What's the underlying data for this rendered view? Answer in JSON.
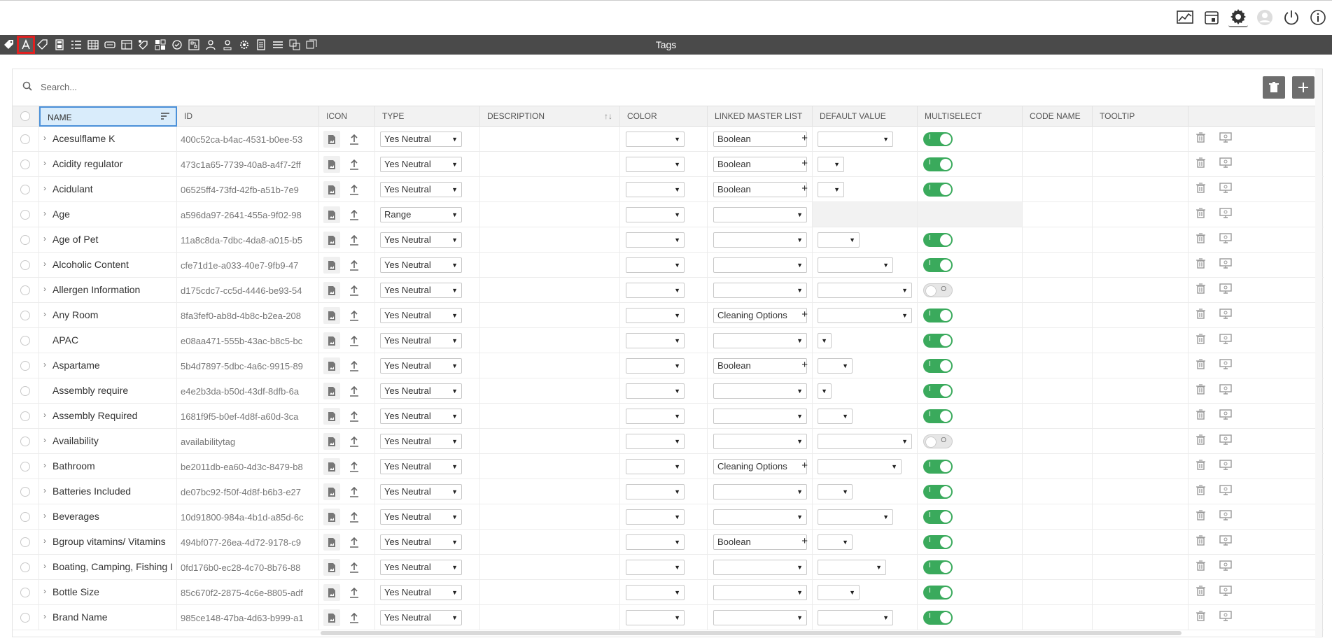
{
  "header": {
    "icons": [
      "chart-icon",
      "calendar-icon",
      "gear-icon",
      "user-icon",
      "power-icon",
      "info-icon"
    ]
  },
  "toolbar": {
    "title": "Tags",
    "icons": [
      "tag-icon",
      "attribute-icon",
      "tag-outline-icon",
      "calculator-icon",
      "checklist-icon",
      "table-icon",
      "card-icon",
      "layout-icon",
      "tag-share-icon",
      "grid-icon",
      "check-circle-icon",
      "tree-icon",
      "person-icon",
      "person-outline-icon",
      "settings-cog-icon",
      "document-list-icon",
      "lines-icon",
      "copy-icon",
      "duplicate-icon"
    ]
  },
  "search": {
    "placeholder": "Search..."
  },
  "columns": {
    "name": "NAME",
    "id": "ID",
    "icon": "ICON",
    "type": "TYPE",
    "description": "DESCRIPTION",
    "color": "COLOR",
    "linked": "LINKED MASTER LIST",
    "default": "DEFAULT VALUE",
    "multiselect": "MULTISELECT",
    "code": "CODE NAME",
    "tooltip": "TOOLTIP"
  },
  "rows": [
    {
      "name": "Acesulflame K",
      "id": "400c52ca-b4ac-4531-b0ee-53",
      "expand": true,
      "type": "Yes Neutral",
      "linked": "Boolean",
      "multiselect": "on"
    },
    {
      "name": "Acidity regulator",
      "id": "473c1a65-7739-40a8-a4f7-2ff",
      "expand": true,
      "type": "Yes Neutral",
      "linked": "Boolean",
      "multiselect": "on"
    },
    {
      "name": "Acidulant",
      "id": "06525ff4-73fd-42fb-a51b-7e9",
      "expand": true,
      "type": "Yes Neutral",
      "linked": "Boolean",
      "multiselect": "on"
    },
    {
      "name": "Age",
      "id": "a596da97-2641-455a-9f02-98",
      "expand": true,
      "type": "Range",
      "linked": "",
      "multiselect": "none"
    },
    {
      "name": "Age of Pet",
      "id": "11a8c8da-7dbc-4da8-a015-b5",
      "expand": true,
      "type": "Yes Neutral",
      "linked": "",
      "multiselect": "on"
    },
    {
      "name": "Alcoholic Content",
      "id": "cfe71d1e-a033-40e7-9fb9-47",
      "expand": true,
      "type": "Yes Neutral",
      "linked": "",
      "multiselect": "on"
    },
    {
      "name": "Allergen Information",
      "id": "d175cdc7-cc5d-4446-be93-54",
      "expand": true,
      "type": "Yes Neutral",
      "linked": "",
      "multiselect": "off"
    },
    {
      "name": "Any Room",
      "id": "8fa3fef0-ab8d-4b8c-b2ea-208",
      "expand": true,
      "type": "Yes Neutral",
      "linked": "Cleaning Options",
      "multiselect": "on"
    },
    {
      "name": "APAC",
      "id": "e08aa471-555b-43ac-b8c5-bc",
      "expand": false,
      "type": "Yes Neutral",
      "linked": "",
      "multiselect": "on"
    },
    {
      "name": "Aspartame",
      "id": "5b4d7897-5dbc-4a6c-9915-89",
      "expand": true,
      "type": "Yes Neutral",
      "linked": "Boolean",
      "multiselect": "on"
    },
    {
      "name": "Assembly require",
      "id": "e4e2b3da-b50d-43df-8dfb-6a",
      "expand": false,
      "type": "Yes Neutral",
      "linked": "",
      "multiselect": "on"
    },
    {
      "name": "Assembly Required",
      "id": "1681f9f5-b0ef-4d8f-a60d-3ca",
      "expand": true,
      "type": "Yes Neutral",
      "linked": "",
      "multiselect": "on"
    },
    {
      "name": "Availability",
      "id": "availabilitytag",
      "expand": true,
      "type": "Yes Neutral",
      "linked": "",
      "multiselect": "off"
    },
    {
      "name": "Bathroom",
      "id": "be2011db-ea60-4d3c-8479-b8",
      "expand": true,
      "type": "Yes Neutral",
      "linked": "Cleaning Options",
      "multiselect": "on"
    },
    {
      "name": "Batteries Included",
      "id": "de07bc92-f50f-4d8f-b6b3-e27",
      "expand": true,
      "type": "Yes Neutral",
      "linked": "",
      "multiselect": "on"
    },
    {
      "name": "Beverages",
      "id": "10d91800-984a-4b1d-a85d-6c",
      "expand": true,
      "type": "Yes Neutral",
      "linked": "",
      "multiselect": "on"
    },
    {
      "name": "Bgroup vitamins/ Vitamins",
      "id": "494bf077-26ea-4d72-9178-c9",
      "expand": true,
      "type": "Yes Neutral",
      "linked": "Boolean",
      "multiselect": "on"
    },
    {
      "name": "Boating, Camping, Fishing I",
      "id": "0fd176b0-ec28-4c70-8b76-88",
      "expand": true,
      "type": "Yes Neutral",
      "linked": "",
      "multiselect": "on"
    },
    {
      "name": "Bottle Size",
      "id": "85c670f2-2875-4c6e-8805-adf",
      "expand": true,
      "type": "Yes Neutral",
      "linked": "",
      "multiselect": "on"
    },
    {
      "name": "Brand Name",
      "id": "985ce148-47ba-4d63-b999-a1",
      "expand": true,
      "type": "Yes Neutral",
      "linked": "",
      "multiselect": "on"
    }
  ],
  "toggle_labels": {
    "on": "I",
    "off": "O"
  },
  "colors": {
    "toggle_on": "#3aaa5c",
    "toolbar_bg": "#4a4a4a",
    "highlight": "#e02020"
  }
}
